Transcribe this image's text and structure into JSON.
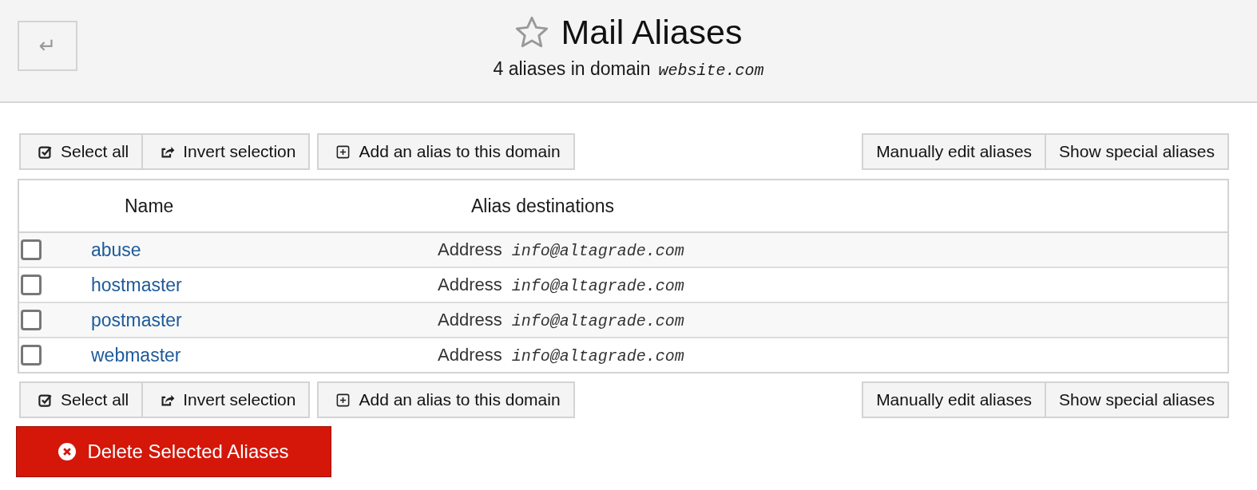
{
  "header": {
    "back_button": "↵",
    "title": "Mail Aliases",
    "subtitle": "4 aliases in domain",
    "domain": "website.com"
  },
  "toolbars": [
    {
      "left": [
        {
          "label": "Select all",
          "kind": "check"
        },
        {
          "label": "Invert selection",
          "kind": "share"
        }
      ],
      "middle": [
        {
          "label": "Add an alias to this domain",
          "kind": "plus"
        }
      ],
      "right": [
        "Manually edit aliases",
        "Show special aliases"
      ]
    },
    {
      "left": [
        {
          "label": "Select all",
          "kind": "check"
        },
        {
          "label": "Invert selection",
          "kind": "share"
        }
      ],
      "middle": [
        {
          "label": "Add an alias to this domain",
          "kind": "plus"
        }
      ],
      "right": [
        "Manually edit aliases",
        "Show special aliases"
      ]
    }
  ],
  "table": {
    "columns": [
      "Name",
      "Alias destinations"
    ],
    "rows": [
      {
        "checked": false,
        "name": "abuse",
        "type": "Address",
        "destination": "info@altagrade.com"
      },
      {
        "checked": false,
        "name": "hostmaster",
        "type": "Address",
        "destination": "info@altagrade.com"
      },
      {
        "checked": false,
        "name": "postmaster",
        "type": "Address",
        "destination": "info@altagrade.com"
      },
      {
        "checked": false,
        "name": "webmaster",
        "type": "Address",
        "destination": "info@altagrade.com"
      }
    ]
  },
  "delete_button": "Delete Selected Aliases"
}
